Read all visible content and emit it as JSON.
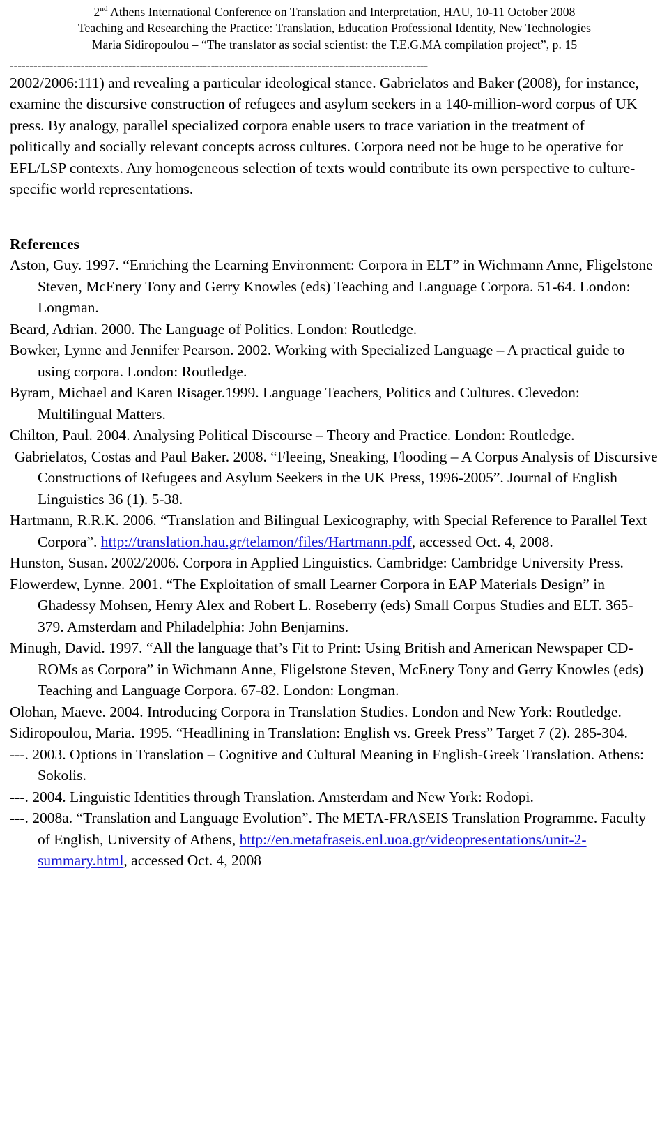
{
  "header": {
    "line1_prefix": "2",
    "line1_sup": "nd",
    "line1_rest": " Athens International Conference on Translation and Interpretation, HAU, 10-11 October 2008",
    "line2": "Teaching and Researching the Practice: Translation, Education Professional Identity, New Technologies",
    "line3": "Maria Sidiropoulou – “The translator as social scientist: the T.E.G.MA compilation project”, p. 15",
    "rule": "----------------------------------------------------------------------------------------------------------"
  },
  "body": {
    "paragraph": "2002/2006:111) and revealing a particular ideological stance. Gabrielatos and Baker (2008), for instance, examine the discursive construction of refugees and asylum seekers in a 140-million-word corpus of UK press. By analogy, parallel specialized corpora enable users to trace variation in the treatment of politically and socially relevant concepts across cultures. Corpora need not be huge to be operative for EFL/LSP contexts. Any homogeneous selection of texts would contribute its own perspective to culture-specific world representations."
  },
  "references": {
    "heading": "References",
    "items": [
      {
        "text": "Aston, Guy. 1997. “Enriching the Learning Environment: Corpora in ELT” in Wichmann Anne, Fligelstone Steven, McEnery Tony and Gerry Knowles (eds) Teaching and Language Corpora. 51-64. London: Longman."
      },
      {
        "text": "Beard, Adrian. 2000. The Language of Politics. London: Routledge."
      },
      {
        "text": "Bowker, Lynne and Jennifer Pearson. 2002. Working with Specialized Language – A practical guide to using corpora. London: Routledge."
      },
      {
        "text": "Byram, Michael and Karen Risager.1999. Language Teachers, Politics and Cultures. Clevedon: Multilingual Matters."
      },
      {
        "text": "Chilton, Paul. 2004. Analysing Political Discourse – Theory and Practice. London: Routledge."
      },
      {
        "text": "Gabrielatos, Costas and Paul Baker. 2008. “Fleeing, Sneaking, Flooding – A Corpus Analysis of Discursive Constructions of Refugees and Asylum Seekers in the UK Press, 1996-2005”. Journal of English Linguistics 36 (1). 5-38."
      },
      {
        "text_before": "Hartmann, R.R.K. 2006. “Translation and Bilingual Lexicography, with Special Reference to Parallel Text Corpora”. ",
        "link": "http://translation.hau.gr/telamon/files/Hartmann.pdf",
        "text_after": ", accessed Oct. 4, 2008."
      },
      {
        "text": "Hunston, Susan. 2002/2006. Corpora in Applied Linguistics. Cambridge: Cambridge University Press."
      },
      {
        "text": "Flowerdew, Lynne. 2001. “The Exploitation of small Learner Corpora in EAP Materials Design” in Ghadessy Mohsen, Henry Alex and Robert L. Roseberry (eds) Small Corpus Studies and ELT. 365-379. Amsterdam and Philadelphia: John Benjamins."
      },
      {
        "text": "Minugh, David. 1997. “All the language that’s Fit to Print: Using British and American Newspaper CD-ROMs as Corpora” in Wichmann Anne, Fligelstone Steven, McEnery Tony and Gerry Knowles (eds) Teaching and Language Corpora. 67-82. London: Longman."
      },
      {
        "text": "Olohan, Maeve. 2004. Introducing Corpora in Translation Studies. London and New York: Routledge."
      },
      {
        "text": "Sidiropoulou, Maria. 1995. “Headlining in Translation: English vs. Greek Press” Target 7 (2). 285-304."
      },
      {
        "text": "---. 2003. Options in Translation – Cognitive and Cultural Meaning in English-Greek Translation. Athens: Sokolis."
      },
      {
        "text": "---. 2004. Linguistic Identities through Translation. Amsterdam and New York: Rodopi."
      },
      {
        "text_before": "---. 2008a. “Translation and Language Evolution”. The META-FRASEIS Translation Programme. Faculty of English, University of Athens, ",
        "link": "http://en.metafraseis.enl.uoa.gr/videopresentations/unit-2-summary.html",
        "text_after": ", accessed Oct. 4, 2008"
      }
    ]
  },
  "colors": {
    "link": "#1414d2",
    "text": "#000000",
    "background": "#ffffff"
  }
}
